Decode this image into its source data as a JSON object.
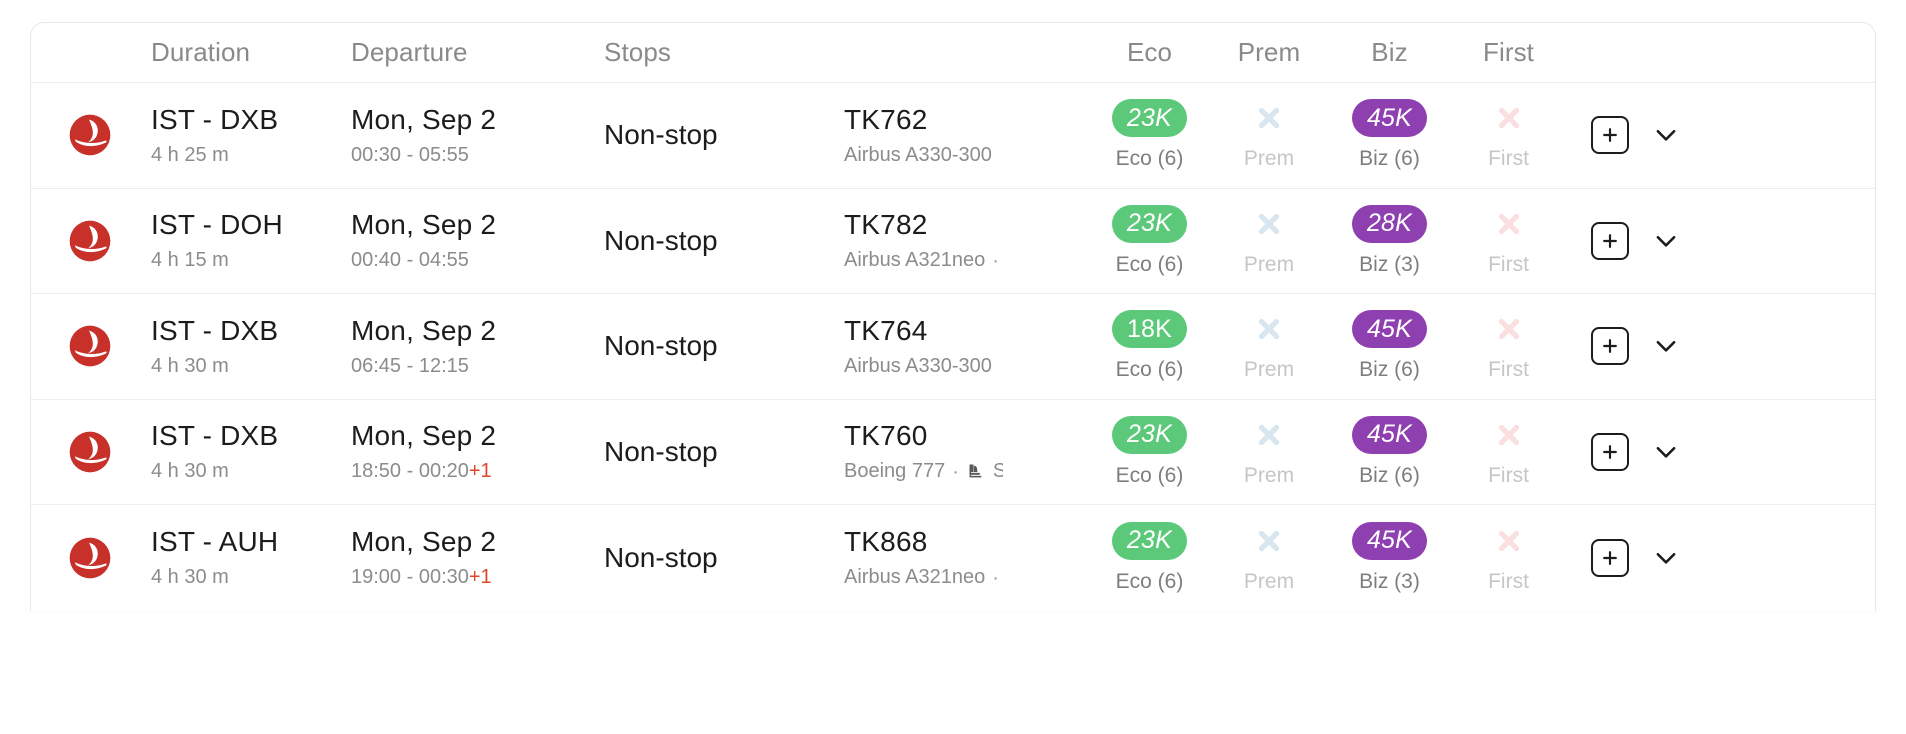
{
  "table": {
    "columns": [
      {
        "key": "airline",
        "label": ""
      },
      {
        "key": "duration",
        "label": "Duration"
      },
      {
        "key": "departure",
        "label": "Departure"
      },
      {
        "key": "stops",
        "label": "Stops"
      },
      {
        "key": "flight",
        "label": ""
      },
      {
        "key": "eco",
        "label": "Eco"
      },
      {
        "key": "prem",
        "label": "Prem"
      },
      {
        "key": "biz",
        "label": "Biz"
      },
      {
        "key": "first",
        "label": "First"
      },
      {
        "key": "actions",
        "label": ""
      }
    ],
    "headers": {
      "duration": "Duration",
      "departure": "Departure",
      "stops": "Stops",
      "eco": "Eco",
      "prem": "Prem",
      "biz": "Biz",
      "first": "First"
    },
    "rows": [
      {
        "airline": "turkish-airlines",
        "route": "IST - DXB",
        "duration": "4 h 25 m",
        "date": "Mon, Sep 2",
        "times": "00:30 - 05:55",
        "next_day": "",
        "stops": "Non-stop",
        "flight_number": "TK762",
        "aircraft": "Airbus A330-300",
        "has_amenities": false,
        "eco": {
          "available": true,
          "miles": "23K",
          "label": "Eco (6)",
          "italic": true
        },
        "prem": {
          "available": false,
          "miles": "",
          "label": "Prem",
          "italic": false
        },
        "biz": {
          "available": true,
          "miles": "45K",
          "label": "Biz (6)",
          "italic": true
        },
        "first": {
          "available": false,
          "miles": "",
          "label": "First",
          "italic": false
        }
      },
      {
        "airline": "turkish-airlines",
        "route": "IST - DOH",
        "duration": "4 h 15 m",
        "date": "Mon, Sep 2",
        "times": "00:40 - 04:55",
        "next_day": "",
        "stops": "Non-stop",
        "flight_number": "TK782",
        "aircraft": "Airbus A321neo",
        "has_amenities": true,
        "amenities_truncated": true,
        "eco": {
          "available": true,
          "miles": "23K",
          "label": "Eco (6)",
          "italic": true
        },
        "prem": {
          "available": false,
          "miles": "",
          "label": "Prem",
          "italic": false
        },
        "biz": {
          "available": true,
          "miles": "28K",
          "label": "Biz (3)",
          "italic": true
        },
        "first": {
          "available": false,
          "miles": "",
          "label": "First",
          "italic": false
        }
      },
      {
        "airline": "turkish-airlines",
        "route": "IST - DXB",
        "duration": "4 h 30 m",
        "date": "Mon, Sep 2",
        "times": "06:45 - 12:15",
        "next_day": "",
        "stops": "Non-stop",
        "flight_number": "TK764",
        "aircraft": "Airbus A330-300",
        "has_amenities": false,
        "eco": {
          "available": true,
          "miles": "18K",
          "label": "Eco (6)",
          "italic": false
        },
        "prem": {
          "available": false,
          "miles": "",
          "label": "Prem",
          "italic": false
        },
        "biz": {
          "available": true,
          "miles": "45K",
          "label": "Biz (6)",
          "italic": true
        },
        "first": {
          "available": false,
          "miles": "",
          "label": "First",
          "italic": false
        }
      },
      {
        "airline": "turkish-airlines",
        "route": "IST - DXB",
        "duration": "4 h 30 m",
        "date": "Mon, Sep 2",
        "times": "18:50 - 00:20",
        "next_day": "+1",
        "stops": "Non-stop",
        "flight_number": "TK760",
        "aircraft": "Boeing 777",
        "has_amenities": true,
        "has_seat_icon": true,
        "amenities_truncated": true,
        "eco": {
          "available": true,
          "miles": "23K",
          "label": "Eco (6)",
          "italic": true
        },
        "prem": {
          "available": false,
          "miles": "",
          "label": "Prem",
          "italic": false
        },
        "biz": {
          "available": true,
          "miles": "45K",
          "label": "Biz (6)",
          "italic": true
        },
        "first": {
          "available": false,
          "miles": "",
          "label": "First",
          "italic": false
        }
      },
      {
        "airline": "turkish-airlines",
        "route": "IST - AUH",
        "duration": "4 h 30 m",
        "date": "Mon, Sep 2",
        "times": "19:00 - 00:30",
        "next_day": "+1",
        "stops": "Non-stop",
        "flight_number": "TK868",
        "aircraft": "Airbus A321neo",
        "has_amenities": true,
        "amenities_truncated": true,
        "eco": {
          "available": true,
          "miles": "23K",
          "label": "Eco (6)",
          "italic": true
        },
        "prem": {
          "available": false,
          "miles": "",
          "label": "Prem",
          "italic": false
        },
        "biz": {
          "available": true,
          "miles": "45K",
          "label": "Biz (3)",
          "italic": true
        },
        "first": {
          "available": false,
          "miles": "",
          "label": "First",
          "italic": false
        }
      }
    ]
  },
  "icons": {
    "add": "plus-in-square-icon",
    "expand": "chevron-down-icon",
    "unavailable": "cross-icon",
    "seat": "seat-icon",
    "airline_logo": "turkish-airlines-logo"
  },
  "colors": {
    "eco_badge": "#5cc97a",
    "biz_badge": "#8e3fb0",
    "prem_unavailable": "#d8e6f0",
    "first_unavailable": "#fadfe0",
    "next_day": "#e0452c",
    "airline_red": "#c8302a",
    "row_divider": "#ededed",
    "header_text": "#8a8a8a",
    "primary_text": "#1c1c1c",
    "secondary_text": "#8c8c8c"
  }
}
